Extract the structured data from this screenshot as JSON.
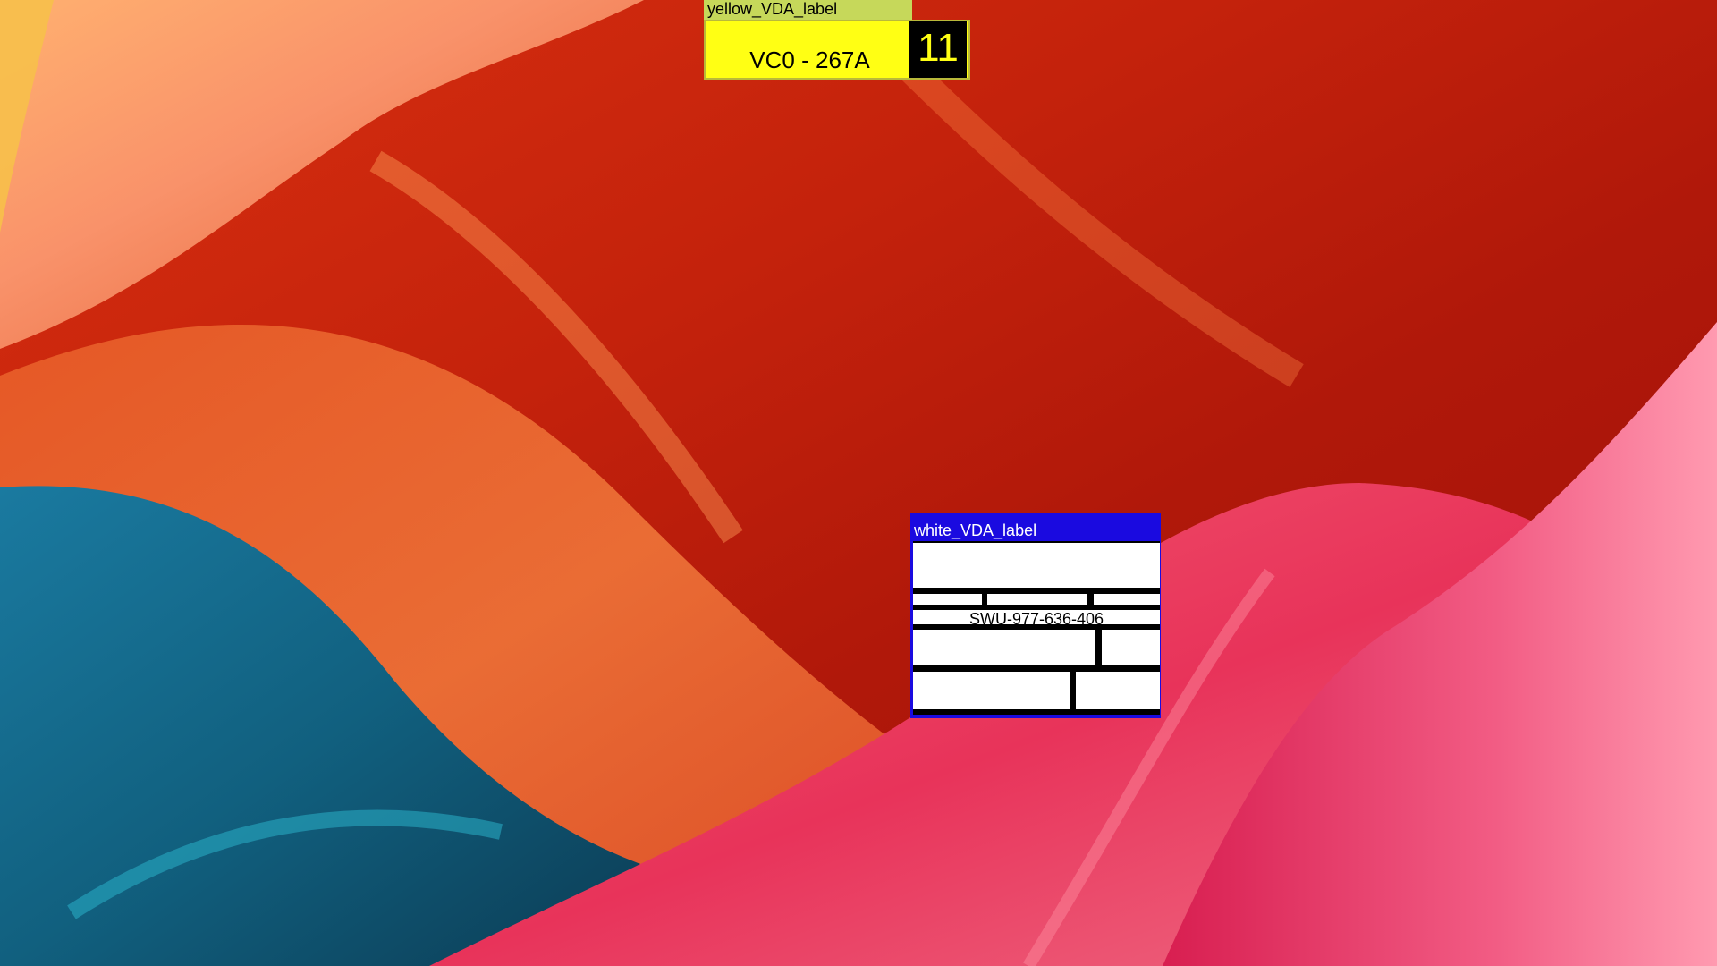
{
  "yellow_label": {
    "title": "yellow_VDA_label",
    "code": "VC0 - 267A",
    "count": "11"
  },
  "white_label": {
    "title": "white_VDA_label",
    "serial": "SWU-977-636-406"
  },
  "colors": {
    "yellow_body": "#ffff14",
    "yellow_titlebar": "#c6d85a",
    "white_titlebar": "#1a0ae0"
  }
}
